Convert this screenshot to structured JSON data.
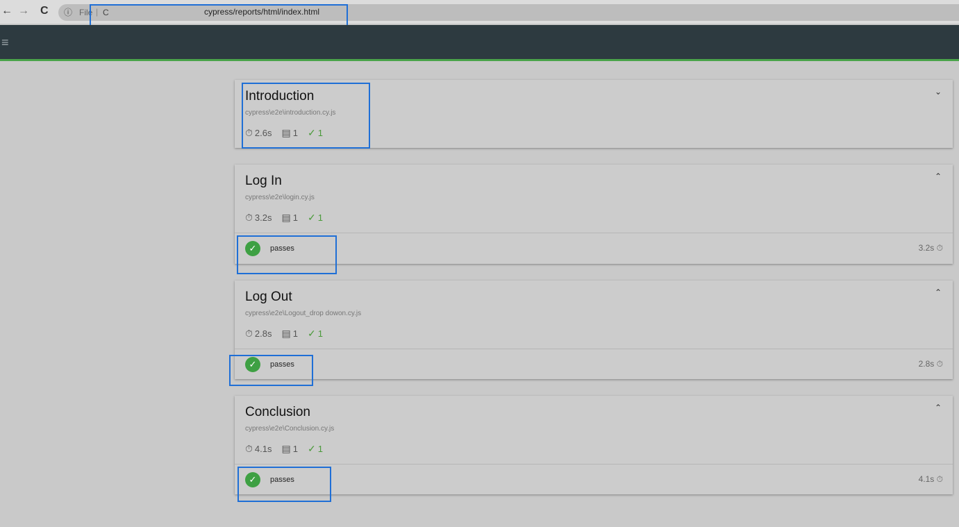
{
  "browser": {
    "back": "←",
    "forward": "→",
    "reload": "C",
    "info": "ⓘ",
    "url_prefix": "File",
    "url_sep": "|",
    "url_c": "C",
    "url_path": "cypress/reports/html/index.html"
  },
  "appbar": {
    "menu": "≡"
  },
  "suites": [
    {
      "title": "Introduction",
      "file": "cypress\\e2e\\introduction.cy.js",
      "duration": "2.6s",
      "tests": "1",
      "passes": "1",
      "chevron": "⌄",
      "expanded": false
    },
    {
      "title": "Log In",
      "file": "cypress\\e2e\\login.cy.js",
      "duration": "3.2s",
      "tests": "1",
      "passes": "1",
      "chevron": "⌃",
      "expanded": true,
      "test": {
        "name": "passes",
        "duration": "3.2s"
      }
    },
    {
      "title": "Log Out",
      "file": "cypress\\e2e\\Logout_drop dowon.cy.js",
      "duration": "2.8s",
      "tests": "1",
      "passes": "1",
      "chevron": "⌃",
      "expanded": true,
      "test": {
        "name": "passes",
        "duration": "2.8s"
      }
    },
    {
      "title": "Conclusion",
      "file": "cypress\\e2e\\Conclusion.cy.js",
      "duration": "4.1s",
      "tests": "1",
      "passes": "1",
      "chevron": "⌃",
      "expanded": true,
      "test": {
        "name": "passes",
        "duration": "4.1s"
      }
    }
  ],
  "icons": {
    "timer": "⏱",
    "clipboard": "📋",
    "check": "✓"
  },
  "colors": {
    "header": "#2d3a40",
    "accent_green": "#4aa34a",
    "pass": "#3ea043",
    "highlight": "#1f6fd6"
  }
}
